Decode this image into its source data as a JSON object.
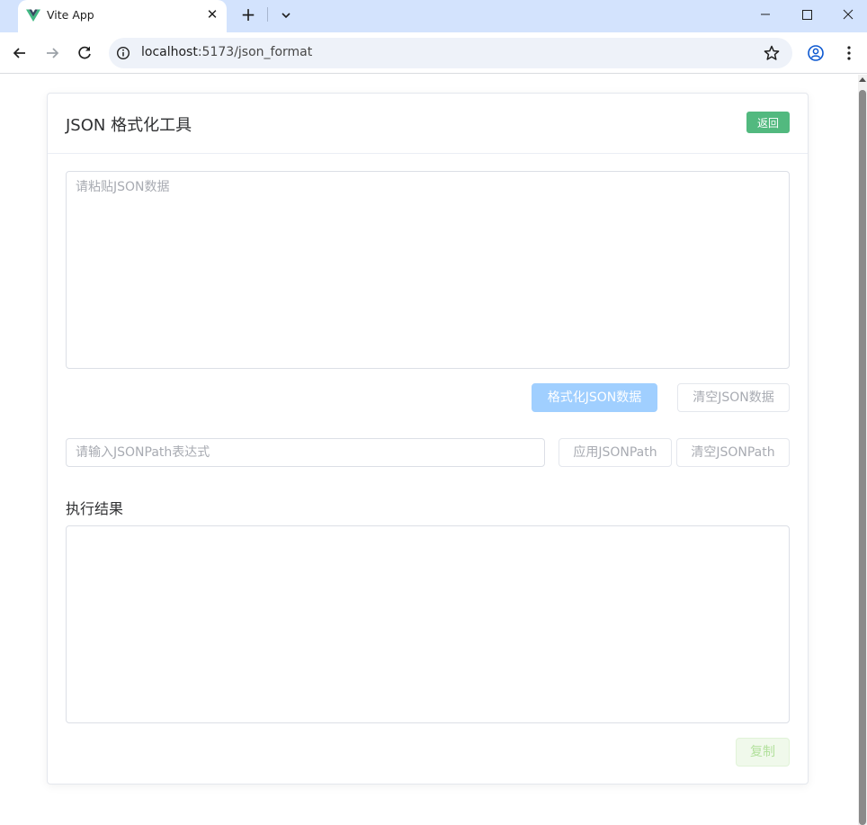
{
  "browser": {
    "tab_title": "Vite App",
    "tab_close": "✕",
    "new_tab": "+",
    "url_host": "localhost",
    "url_path": ":5173/json_format",
    "colors": {
      "frame": "#d3e3fd",
      "omnibox": "#eef2f9",
      "vue_green": "#41b883",
      "vue_dark": "#35495e"
    }
  },
  "page": {
    "title": "JSON 格式化工具",
    "back_label": "返回",
    "json_input": {
      "placeholder": "请粘贴JSON数据",
      "value": ""
    },
    "format_label": "格式化JSON数据",
    "clear_json_label": "清空JSON数据",
    "jsonpath_input": {
      "placeholder": "请输入JSONPath表达式",
      "value": ""
    },
    "apply_jsonpath_label": "应用JSONPath",
    "clear_jsonpath_label": "清空JSONPath",
    "result_title": "执行结果",
    "result_value": "",
    "copy_label": "复制",
    "colors": {
      "success": "#52b97f",
      "primary_disabled": "#a0cfff",
      "border": "#dcdfe6",
      "placeholder": "#a8abb2"
    }
  }
}
